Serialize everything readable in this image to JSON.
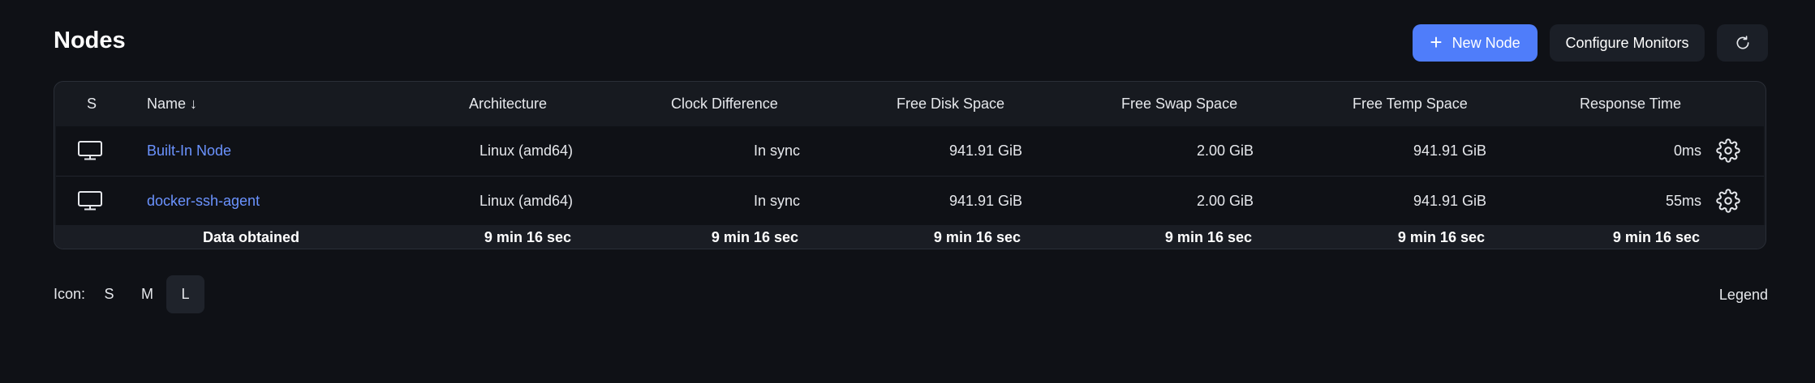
{
  "page": {
    "title": "Nodes"
  },
  "toolbar": {
    "new_node_label": "New Node",
    "configure_monitors_label": "Configure Monitors",
    "refresh_icon": "refresh-icon"
  },
  "table": {
    "columns": {
      "status": "S",
      "name": "Name ↓",
      "architecture": "Architecture",
      "clock": "Clock Difference",
      "disk": "Free Disk Space",
      "swap": "Free Swap Space",
      "temp": "Free Temp Space",
      "response": "Response Time"
    },
    "rows": [
      {
        "name": "Built-In Node",
        "architecture": "Linux (amd64)",
        "clock": "In sync",
        "disk": "941.91 GiB",
        "swap": "2.00 GiB",
        "temp": "941.91 GiB",
        "response": "0ms"
      },
      {
        "name": "docker-ssh-agent",
        "architecture": "Linux (amd64)",
        "clock": "In sync",
        "disk": "941.91 GiB",
        "swap": "2.00 GiB",
        "temp": "941.91 GiB",
        "response": "55ms"
      }
    ],
    "footer": {
      "label": "Data obtained",
      "architecture": "9 min 16 sec",
      "clock": "9 min 16 sec",
      "disk": "9 min 16 sec",
      "swap": "9 min 16 sec",
      "temp": "9 min 16 sec",
      "response": "9 min 16 sec"
    }
  },
  "icon_size": {
    "label": "Icon:",
    "options": [
      "S",
      "M",
      "L"
    ],
    "selected": "L"
  },
  "legend_label": "Legend",
  "colors": {
    "background": "#0f1116",
    "accent": "#4f7dfa",
    "link": "#6b93ff"
  }
}
